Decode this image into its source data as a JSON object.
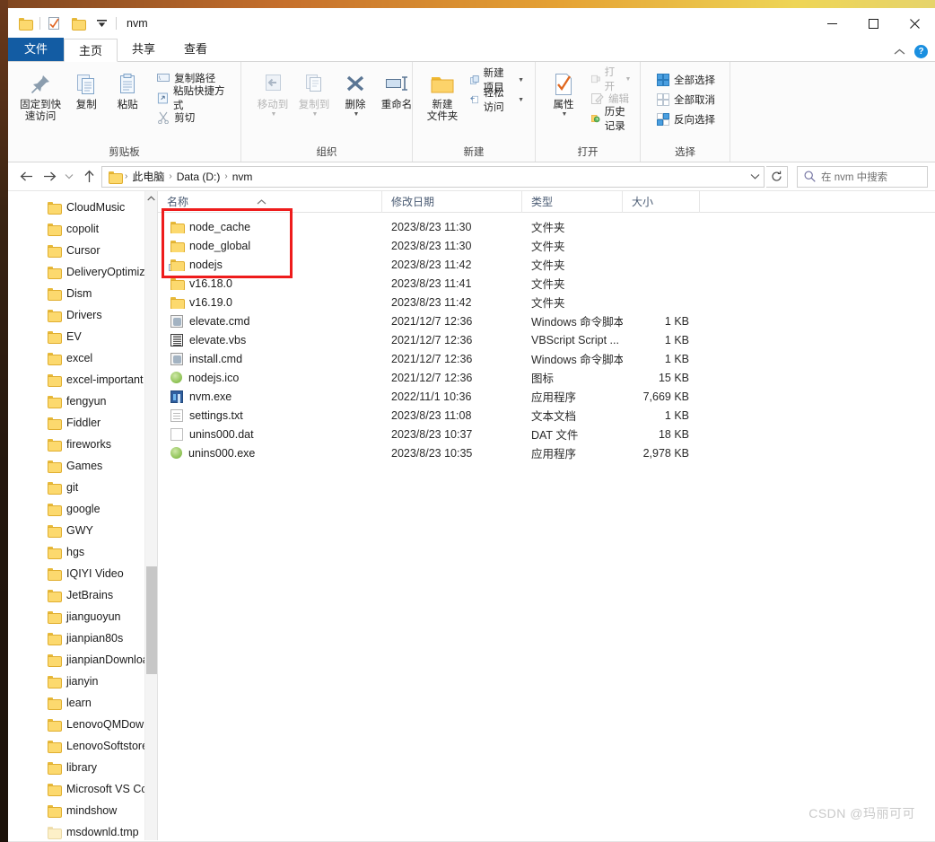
{
  "window": {
    "title": "nvm",
    "quick_access": [
      "folder-icon",
      "properties-icon",
      "new-folder-icon",
      "customize-dropdown-icon"
    ],
    "minimize_label": "—",
    "maximize_label": "□",
    "close_label": "✕"
  },
  "ribbon": {
    "tabs": [
      {
        "label": "文件",
        "name": "tab-file"
      },
      {
        "label": "主页",
        "name": "tab-home"
      },
      {
        "label": "共享",
        "name": "tab-share"
      },
      {
        "label": "查看",
        "name": "tab-view"
      }
    ],
    "collapse_icon": "chevron-up-icon",
    "help_label": "?",
    "groups": [
      {
        "title": "剪贴板",
        "big": [
          {
            "label": "固定到快\n速访问",
            "line1": "固定到快",
            "line2": "速访问",
            "icon": "pin-icon"
          },
          {
            "label": "复制",
            "line1": "复制",
            "line2": "",
            "icon": "copy-icon"
          },
          {
            "label": "粘贴",
            "line1": "粘贴",
            "line2": "",
            "icon": "paste-icon"
          }
        ],
        "small": [
          {
            "label": "复制路径",
            "icon": "copy-path-icon"
          },
          {
            "label": "粘贴快捷方式",
            "icon": "paste-shortcut-icon"
          },
          {
            "label": "剪切",
            "icon": "scissors-icon"
          }
        ]
      },
      {
        "title": "组织",
        "big": [
          {
            "line1": "移动到",
            "line2": "",
            "icon": "move-to-icon",
            "dim": true,
            "caret": true
          },
          {
            "line1": "复制到",
            "line2": "",
            "icon": "copy-to-icon",
            "dim": true,
            "caret": true
          },
          {
            "line1": "删除",
            "line2": "",
            "icon": "delete-icon",
            "caret": true
          },
          {
            "line1": "重命名",
            "line2": "",
            "icon": "rename-icon"
          }
        ],
        "small": []
      },
      {
        "title": "新建",
        "big": [
          {
            "line1": "新建",
            "line2": "文件夹",
            "icon": "new-folder-icon"
          }
        ],
        "small": [
          {
            "label": "新建项目",
            "icon": "new-item-icon",
            "caret": true
          },
          {
            "label": "轻松访问",
            "icon": "easy-access-icon",
            "caret": true
          }
        ]
      },
      {
        "title": "打开",
        "big": [
          {
            "line1": "属性",
            "line2": "",
            "icon": "properties-icon",
            "caret": true
          }
        ],
        "small": [
          {
            "label": "打开",
            "icon": "open-icon",
            "dim": true,
            "caret": true
          },
          {
            "label": "编辑",
            "icon": "edit-icon",
            "dim": true
          },
          {
            "label": "历史记录",
            "icon": "history-icon"
          }
        ]
      },
      {
        "title": "选择",
        "big": [],
        "small": [
          {
            "label": "全部选择",
            "icon": "select-all-icon"
          },
          {
            "label": "全部取消",
            "icon": "select-none-icon"
          },
          {
            "label": "反向选择",
            "icon": "invert-selection-icon"
          }
        ]
      }
    ]
  },
  "addressbar": {
    "back_icon": "arrow-left-icon",
    "forward_icon": "arrow-right-icon",
    "recent_icon": "chevron-down-icon",
    "up_icon": "arrow-up-icon",
    "breadcrumbs": [
      "此电脑",
      "Data (D:)",
      "nvm"
    ],
    "dropdown_icon": "chevron-down-icon",
    "refresh_icon": "refresh-icon",
    "search_icon": "search-icon",
    "search_placeholder": "在 nvm 中搜索",
    "search_value": ""
  },
  "navpane": {
    "items": [
      {
        "label": "CloudMusic",
        "icon": "folder-icon"
      },
      {
        "label": "copolit",
        "icon": "folder-icon"
      },
      {
        "label": "Cursor",
        "icon": "folder-icon"
      },
      {
        "label": "DeliveryOptimiz",
        "icon": "folder-icon"
      },
      {
        "label": "Dism",
        "icon": "folder-icon"
      },
      {
        "label": "Drivers",
        "icon": "folder-icon"
      },
      {
        "label": "EV",
        "icon": "folder-icon"
      },
      {
        "label": "excel",
        "icon": "folder-icon"
      },
      {
        "label": "excel-important",
        "icon": "folder-icon"
      },
      {
        "label": "fengyun",
        "icon": "folder-icon"
      },
      {
        "label": "Fiddler",
        "icon": "folder-icon"
      },
      {
        "label": "fireworks",
        "icon": "folder-icon"
      },
      {
        "label": "Games",
        "icon": "folder-icon"
      },
      {
        "label": "git",
        "icon": "folder-icon"
      },
      {
        "label": "google",
        "icon": "folder-icon"
      },
      {
        "label": "GWY",
        "icon": "folder-icon"
      },
      {
        "label": "hgs",
        "icon": "folder-icon"
      },
      {
        "label": "IQIYI Video",
        "icon": "folder-icon"
      },
      {
        "label": "JetBrains",
        "icon": "folder-icon"
      },
      {
        "label": "jianguoyun",
        "icon": "folder-icon"
      },
      {
        "label": "jianpian80s",
        "icon": "folder-icon"
      },
      {
        "label": "jianpianDownloa",
        "icon": "folder-icon"
      },
      {
        "label": "jianyin",
        "icon": "folder-icon"
      },
      {
        "label": "learn",
        "icon": "folder-icon"
      },
      {
        "label": "LenovoQMDowr",
        "icon": "folder-icon"
      },
      {
        "label": "LenovoSoftstore",
        "icon": "folder-icon"
      },
      {
        "label": "library",
        "icon": "folder-icon"
      },
      {
        "label": "Microsoft VS Cc",
        "icon": "folder-icon"
      },
      {
        "label": "mindshow",
        "icon": "folder-icon"
      },
      {
        "label": "msdownld.tmp",
        "icon": "folder-pale-icon"
      }
    ],
    "scroll_up_icon": "chevron-up-icon",
    "scroll_down_icon": "chevron-down-icon"
  },
  "filelist": {
    "columns": [
      {
        "label": "名称",
        "key": "name",
        "sorted": "asc"
      },
      {
        "label": "修改日期",
        "key": "date"
      },
      {
        "label": "类型",
        "key": "type"
      },
      {
        "label": "大小",
        "key": "size"
      }
    ],
    "sort_icon": "chevron-up-icon",
    "rows": [
      {
        "name": "node_cache",
        "date": "2023/8/23 11:30",
        "type": "文件夹",
        "size": "",
        "icon": "folder-icon"
      },
      {
        "name": "node_global",
        "date": "2023/8/23 11:30",
        "type": "文件夹",
        "size": "",
        "icon": "folder-icon"
      },
      {
        "name": "nodejs",
        "date": "2023/8/23 11:42",
        "type": "文件夹",
        "size": "",
        "icon": "folder-shortcut-icon"
      },
      {
        "name": "v16.18.0",
        "date": "2023/8/23 11:41",
        "type": "文件夹",
        "size": "",
        "icon": "folder-icon"
      },
      {
        "name": "v16.19.0",
        "date": "2023/8/23 11:42",
        "type": "文件夹",
        "size": "",
        "icon": "folder-icon"
      },
      {
        "name": "elevate.cmd",
        "date": "2021/12/7 12:36",
        "type": "Windows 命令脚本",
        "size": "1 KB",
        "icon": "cmd-icon"
      },
      {
        "name": "elevate.vbs",
        "date": "2021/12/7 12:36",
        "type": "VBScript Script ...",
        "size": "1 KB",
        "icon": "vbs-icon"
      },
      {
        "name": "install.cmd",
        "date": "2021/12/7 12:36",
        "type": "Windows 命令脚本",
        "size": "1 KB",
        "icon": "cmd-icon"
      },
      {
        "name": "nodejs.ico",
        "date": "2021/12/7 12:36",
        "type": "图标",
        "size": "15 KB",
        "icon": "ico-icon"
      },
      {
        "name": "nvm.exe",
        "date": "2022/11/1 10:36",
        "type": "应用程序",
        "size": "7,669 KB",
        "icon": "exe-blue-icon"
      },
      {
        "name": "settings.txt",
        "date": "2023/8/23 11:08",
        "type": "文本文档",
        "size": "1 KB",
        "icon": "text-doc-icon"
      },
      {
        "name": "unins000.dat",
        "date": "2023/8/23 10:37",
        "type": "DAT 文件",
        "size": "18 KB",
        "icon": "dat-icon"
      },
      {
        "name": "unins000.exe",
        "date": "2023/8/23 10:35",
        "type": "应用程序",
        "size": "2,978 KB",
        "icon": "exe-green-icon"
      }
    ]
  },
  "annotation": {
    "highlight_color": "#ee1c1c",
    "highlight_rows": [
      "node_cache",
      "node_global",
      "nodejs"
    ]
  },
  "watermark": {
    "text": "CSDN @玛丽可可"
  }
}
